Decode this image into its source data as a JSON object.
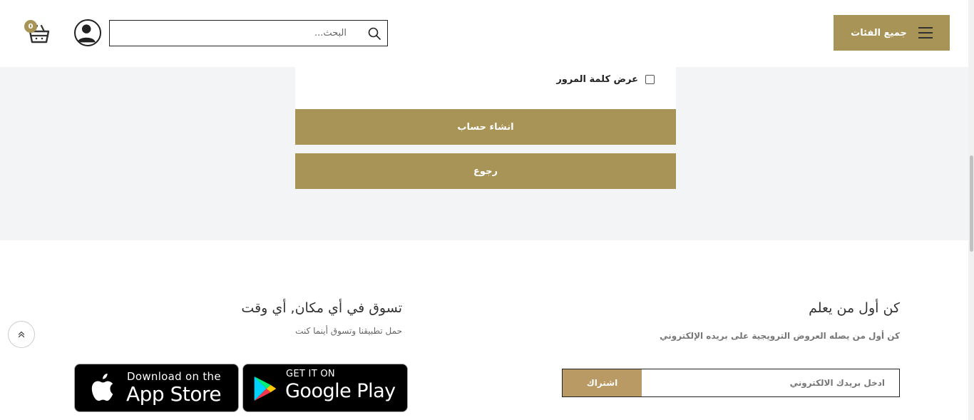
{
  "header": {
    "categories_label": "جميع الفئات",
    "search_placeholder": "البحث...",
    "cart_count": "0"
  },
  "form": {
    "show_password_label": "عرض كلمة المرور",
    "create_account_label": "انشاء حساب",
    "back_label": "رجوع"
  },
  "footer": {
    "newsletter": {
      "title": "كن أول من يعلم",
      "subtitle": "كن أول من يصله العروض الترويجية على بريده الإلكتروني",
      "email_placeholder": "ادخل بريدك الالكتروني",
      "subscribe_label": "اشتراك"
    },
    "apps": {
      "title": "تسوق في أي مكان, أي وقت",
      "subtitle": "حمل تطبيقنا وتسوق أينما كنت",
      "google_play": {
        "small": "GET IT ON",
        "big": "Google Play"
      },
      "app_store": {
        "small": "Download on the",
        "big": "App Store"
      }
    }
  },
  "colors": {
    "accent": "#a99458",
    "subscribe": "#b99a64",
    "background": "#f3f4f6"
  },
  "icons": [
    "menu-icon",
    "search-icon",
    "user-icon",
    "cart-icon",
    "apple-icon",
    "google-play-icon",
    "chevron-up-double-icon"
  ]
}
